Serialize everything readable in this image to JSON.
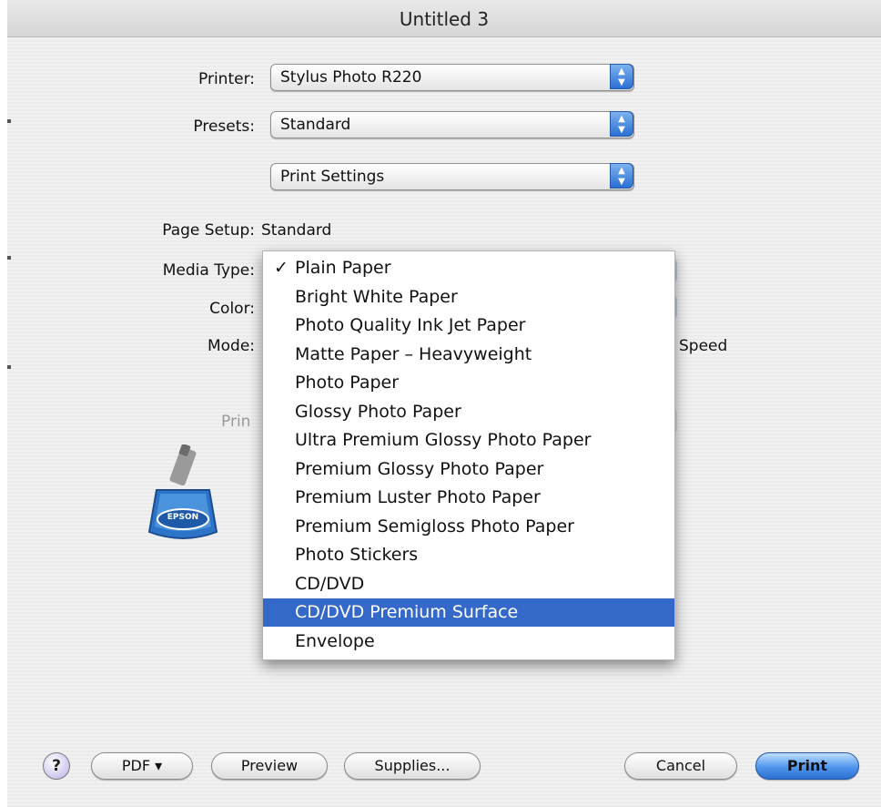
{
  "window": {
    "title": "Untitled 3"
  },
  "printer": {
    "label": "Printer:",
    "value": "Stylus Photo R220"
  },
  "presets": {
    "label": "Presets:",
    "value": "Standard"
  },
  "panel": {
    "value": "Print Settings"
  },
  "page_setup": {
    "label": "Page Setup:",
    "value": "Standard"
  },
  "media_type": {
    "label": "Media Type:",
    "options": [
      {
        "label": "Plain Paper",
        "checked": true
      },
      {
        "label": "Bright White Paper"
      },
      {
        "label": "Photo Quality Ink Jet Paper"
      },
      {
        "label": "Matte Paper – Heavyweight"
      },
      {
        "label": "Photo Paper"
      },
      {
        "label": "Glossy Photo Paper"
      },
      {
        "label": "Ultra Premium Glossy Photo Paper"
      },
      {
        "label": "Premium Glossy Photo Paper"
      },
      {
        "label": "Premium Luster Photo Paper"
      },
      {
        "label": "Premium Semigloss Photo Paper"
      },
      {
        "label": "Photo Stickers"
      },
      {
        "label": "CD/DVD"
      },
      {
        "label": "CD/DVD Premium Surface",
        "highlighted": true
      },
      {
        "label": "Envelope"
      }
    ],
    "checkmark": "✓"
  },
  "color": {
    "label": "Color:"
  },
  "mode": {
    "label": "Mode:",
    "speed_label": "Speed"
  },
  "print_quality": {
    "label_partial": "Prin"
  },
  "epson": {
    "icon": "epson-printer-icon",
    "brand": "EPSON"
  },
  "buttons": {
    "help": "?",
    "pdf": "PDF ▾",
    "preview": "Preview",
    "supplies": "Supplies...",
    "cancel": "Cancel",
    "print": "Print"
  },
  "colors": {
    "highlight": "#3468c9",
    "default_button": "#4f95ec"
  }
}
